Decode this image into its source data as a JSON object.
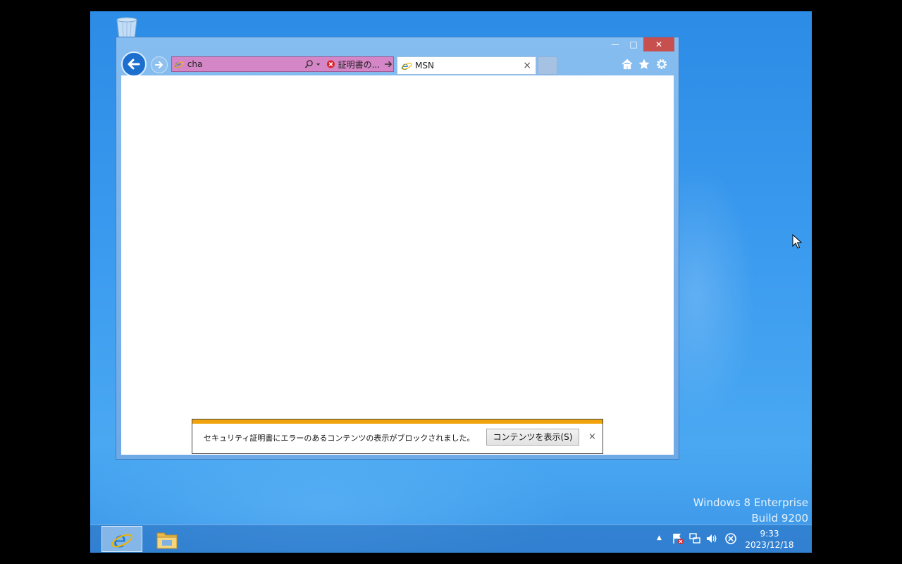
{
  "browser": {
    "address_value": "cha",
    "cert_error_label": "証明書の...",
    "tab_title": "MSN",
    "tab_close": "×",
    "window_min": "—",
    "window_max": "□",
    "window_close": "✕"
  },
  "notification": {
    "message": "セキュリティ証明書にエラーのあるコンテンツの表示がブロックされました。",
    "button_label": "コンテンツを表示(S)",
    "close": "×"
  },
  "watermark": {
    "line1": "Windows 8 Enterprise",
    "line2": "Build 9200"
  },
  "taskbar": {
    "time": "9:33",
    "date": "2023/12/18",
    "overflow_arrow": "▲"
  },
  "colors": {
    "address_error_bg": "#d586c7",
    "notification_stripe": "#f0a30a",
    "close_button": "#c7504f",
    "back_button": "#1d6fce"
  },
  "icons": [
    "recycle-bin-icon",
    "back-arrow-icon",
    "forward-arrow-icon",
    "ie-logo-icon",
    "search-icon",
    "dropdown-icon",
    "cert-error-icon",
    "go-arrow-icon",
    "home-icon",
    "favorites-star-icon",
    "settings-gear-icon",
    "folder-icon",
    "flag-icon",
    "network-icon",
    "volume-icon",
    "error-circle-icon"
  ]
}
